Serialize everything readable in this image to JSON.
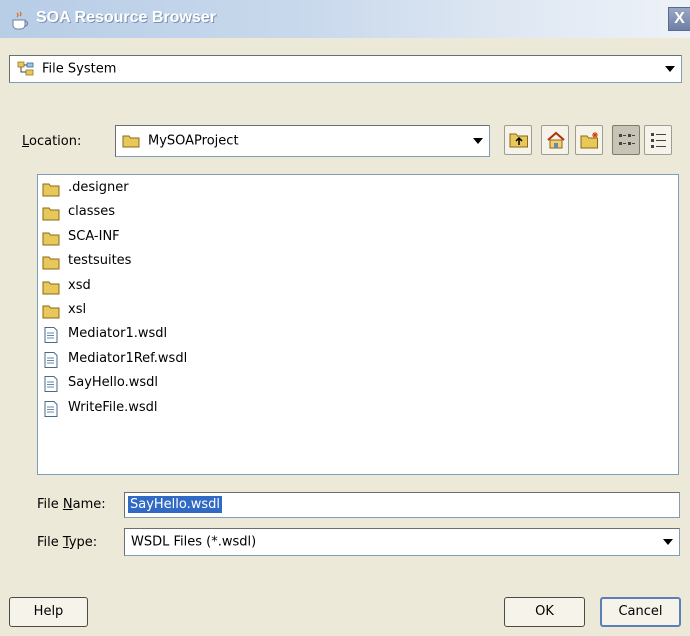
{
  "window": {
    "title": "SOA Resource Browser",
    "close_glyph": "X"
  },
  "source_combo": {
    "value": "File System",
    "icon": "file-system-icon"
  },
  "location": {
    "label_prefix": "",
    "label_accel": "L",
    "label_rest": "ocation:",
    "value": "MySOAProject",
    "icon": "folder-icon"
  },
  "toolbar": {
    "buttons": [
      "up-folder-icon",
      "home-icon",
      "new-folder-icon",
      "list-view-icon",
      "details-view-icon"
    ]
  },
  "files": [
    {
      "name": ".designer",
      "kind": "folder"
    },
    {
      "name": "classes",
      "kind": "folder"
    },
    {
      "name": "SCA-INF",
      "kind": "folder"
    },
    {
      "name": "testsuites",
      "kind": "folder"
    },
    {
      "name": "xsd",
      "kind": "folder"
    },
    {
      "name": "xsl",
      "kind": "folder"
    },
    {
      "name": "Mediator1.wsdl",
      "kind": "file"
    },
    {
      "name": "Mediator1Ref.wsdl",
      "kind": "file"
    },
    {
      "name": "SayHello.wsdl",
      "kind": "file"
    },
    {
      "name": "WriteFile.wsdl",
      "kind": "file"
    }
  ],
  "file_name": {
    "label_prefix": "File ",
    "label_accel": "N",
    "label_rest": "ame:",
    "value": "SayHello.wsdl"
  },
  "file_type": {
    "label_prefix": "File ",
    "label_accel": "T",
    "label_rest": "ype:",
    "value": "WSDL Files (*.wsdl)"
  },
  "buttons": {
    "help": "Help",
    "ok": "OK",
    "cancel": "Cancel"
  },
  "colors": {
    "folder": "#e8c85a",
    "selection": "#316ac5",
    "dialog_bg": "#ece9d8"
  }
}
